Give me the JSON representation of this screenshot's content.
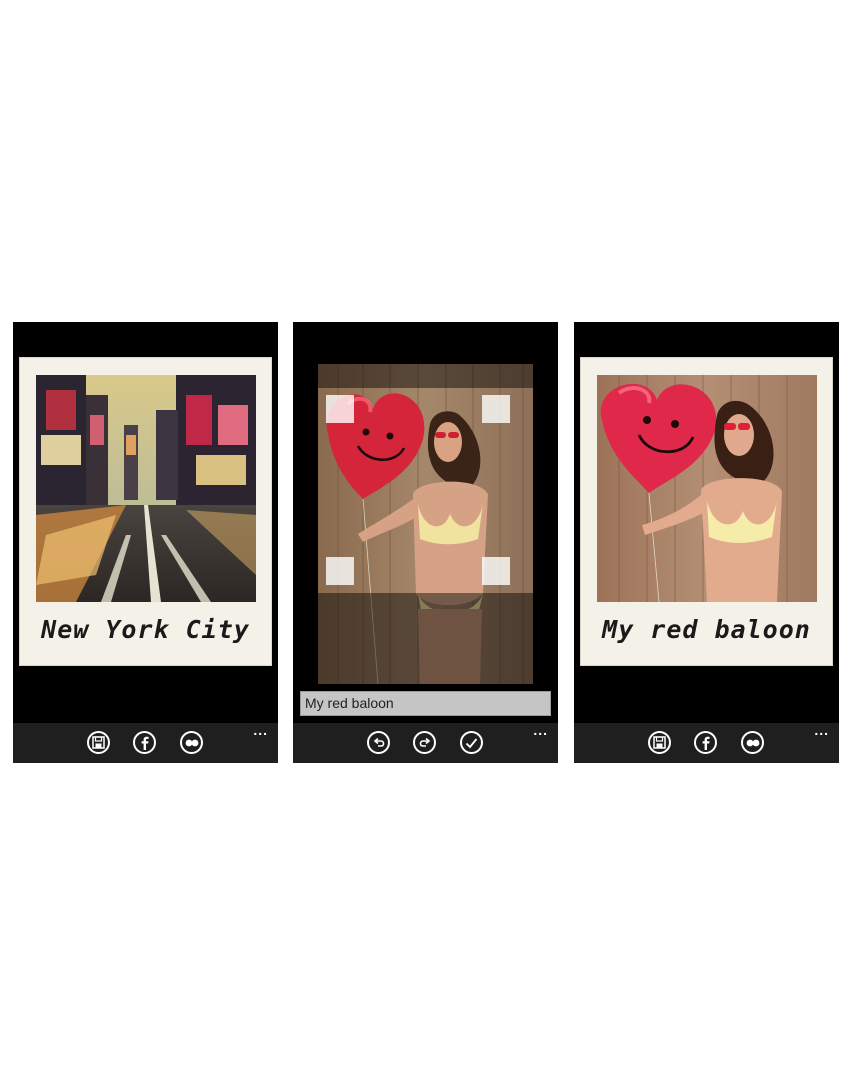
{
  "screens": [
    {
      "caption": "New York City",
      "appbar": {
        "buttons": [
          "save-icon",
          "facebook-icon",
          "flickr-icon"
        ],
        "more": "..."
      }
    },
    {
      "caption_input_value": "My red baloon",
      "appbar": {
        "buttons": [
          "undo-icon",
          "redo-icon",
          "check-icon"
        ],
        "more": "..."
      }
    },
    {
      "caption": "My red baloon",
      "appbar": {
        "buttons": [
          "save-icon",
          "facebook-icon",
          "flickr-icon"
        ],
        "more": "..."
      }
    }
  ],
  "colors": {
    "phone_background": "#000000",
    "appbar_background": "#1f1f1f",
    "polaroid_frame": "#f4f1e8",
    "balloon_red": "#d4253a"
  }
}
